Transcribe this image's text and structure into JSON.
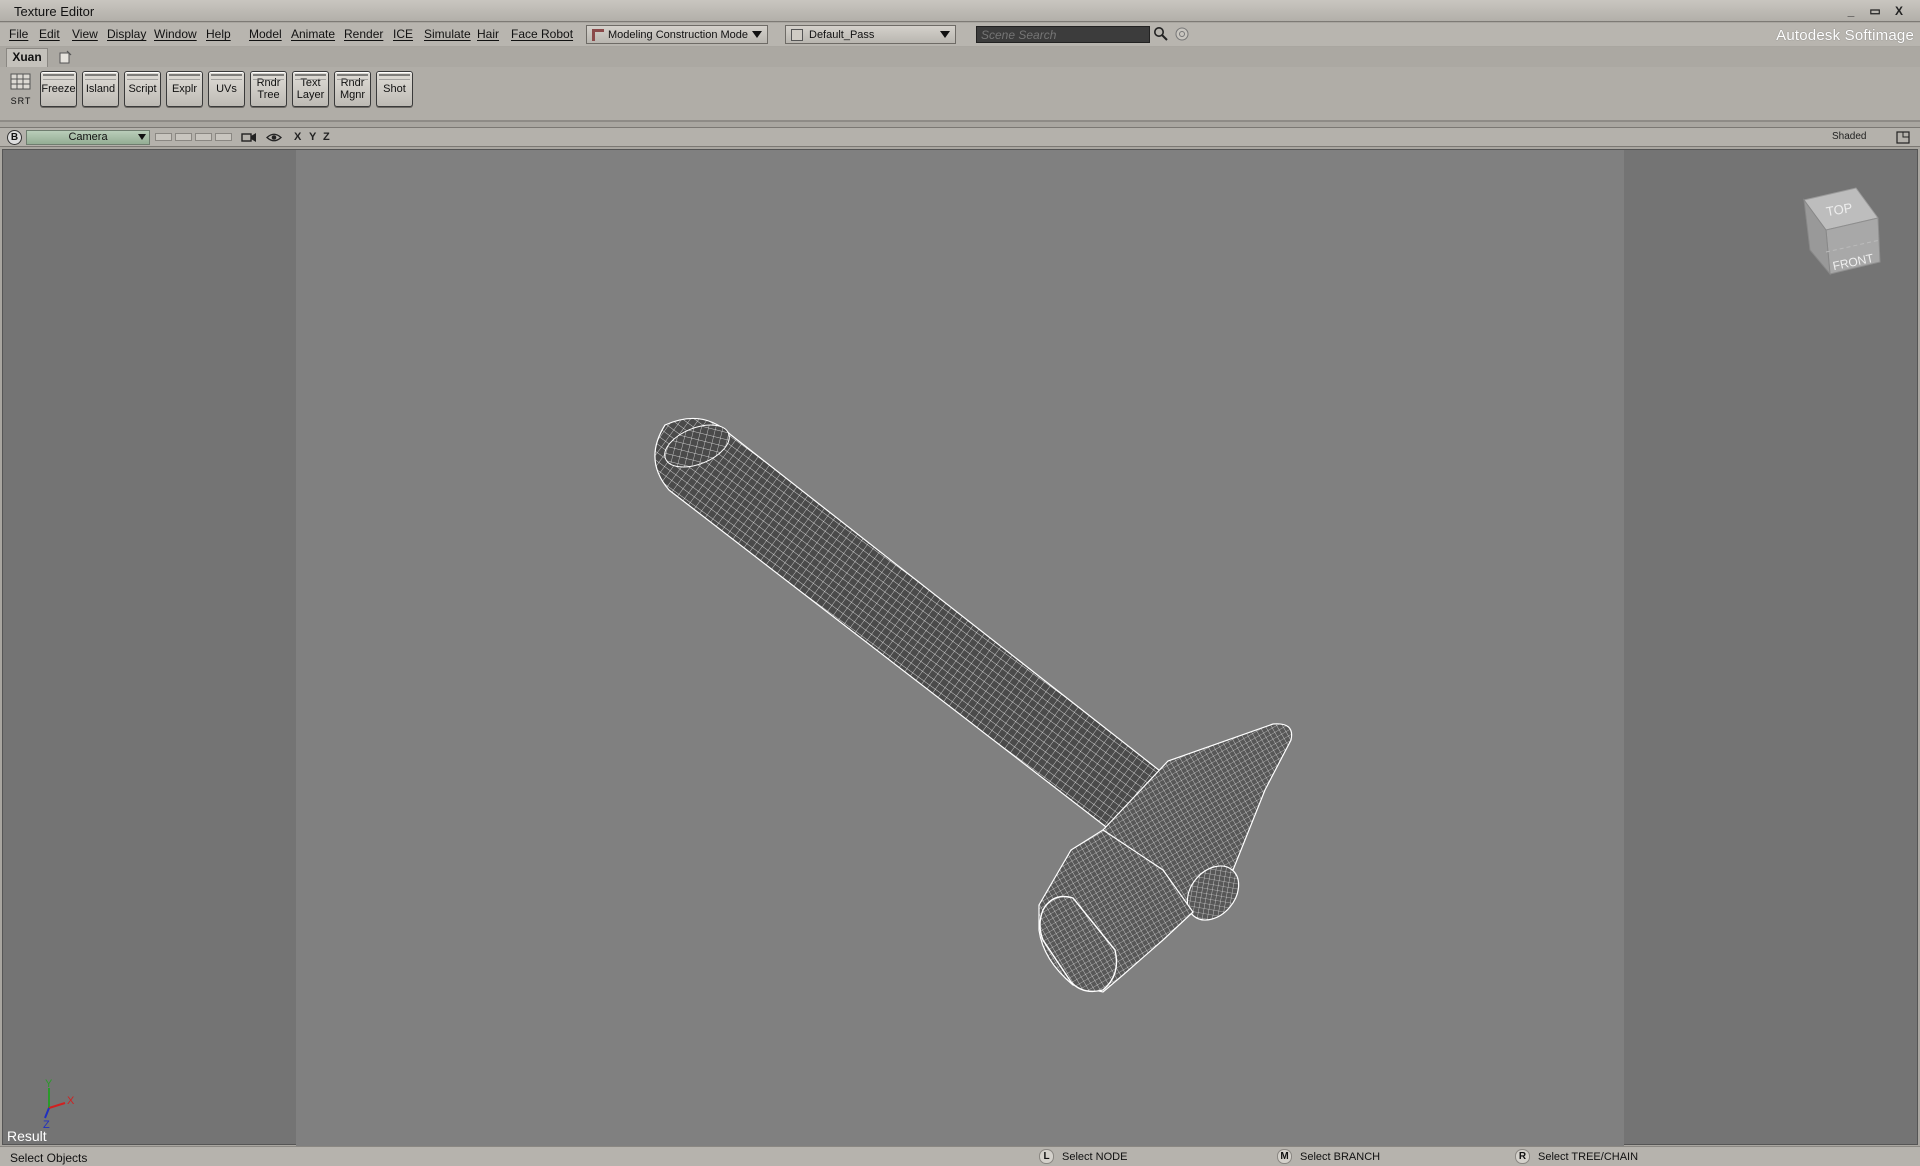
{
  "window": {
    "title": "Texture Editor",
    "buttons": [
      "_",
      "▭",
      "X"
    ]
  },
  "menubar": {
    "items": [
      "File",
      "Edit",
      "View",
      "Display",
      "Window",
      "Help"
    ],
    "modules": [
      "Model",
      "Animate",
      "Render",
      "ICE",
      "Simulate",
      "Hair",
      "Face Robot"
    ],
    "construction_mode": "Modeling Construction Mode",
    "pass": "Default_Pass",
    "search_placeholder": "Scene Search",
    "brand": "Autodesk Softimage"
  },
  "tabs": {
    "active": "Xuan"
  },
  "toolbar": {
    "srt_label": "SRT",
    "buttons": [
      "Freeze",
      "Island",
      "Script",
      "Explr",
      "UVs",
      "Rndr Tree",
      "Text Layer",
      "Rndr Mgnr",
      "Shot"
    ]
  },
  "viewport": {
    "letter": "B",
    "camera": "Camera",
    "axes": [
      "X",
      "Y",
      "Z"
    ],
    "display_mode": "Shaded",
    "cube_top": "TOP",
    "cube_front": "FRONT",
    "gizmo_axes": [
      "Y",
      "X",
      "Z"
    ],
    "result_label": "Result"
  },
  "statusbar": {
    "message": "Select Objects",
    "hints": [
      {
        "key": "L",
        "text": "Select NODE"
      },
      {
        "key": "M",
        "text": "Select BRANCH"
      },
      {
        "key": "R",
        "text": "Select TREE/CHAIN"
      }
    ]
  },
  "colors": {
    "viewport_bg": "#747474",
    "frame_bg": "#808080",
    "wire": "#ffffff",
    "camera_dd": "#9fb89f"
  }
}
